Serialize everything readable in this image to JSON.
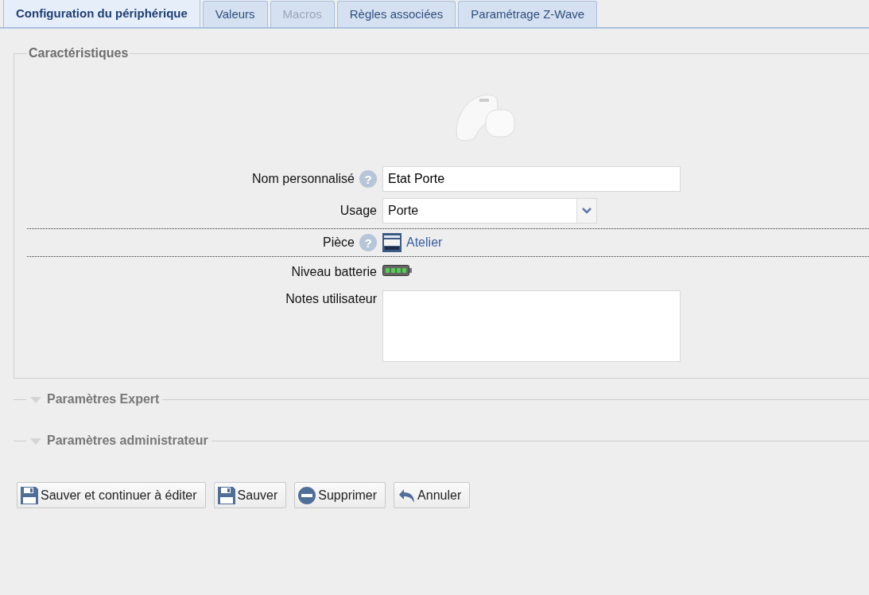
{
  "tabs": [
    {
      "label": "Configuration du périphérique",
      "selected": true,
      "disabled": false
    },
    {
      "label": "Valeurs",
      "selected": false,
      "disabled": false
    },
    {
      "label": "Macros",
      "selected": false,
      "disabled": true
    },
    {
      "label": "Règles associées",
      "selected": false,
      "disabled": false
    },
    {
      "label": "Paramétrage Z-Wave",
      "selected": false,
      "disabled": false
    }
  ],
  "characteristics": {
    "legend": "Caractéristiques",
    "fields": [
      {
        "kind": "text",
        "label": "Nom personnalisé",
        "help": "?",
        "value": "Etat Porte"
      },
      {
        "kind": "select",
        "label": "Usage",
        "value": "Porte"
      },
      {
        "kind": "link",
        "label": "Pièce",
        "help": "?",
        "value": "Atelier"
      },
      {
        "kind": "battery",
        "label": "Niveau batterie"
      },
      {
        "kind": "textarea",
        "label": "Notes utilisateur"
      }
    ]
  },
  "sections": [
    {
      "title": "Paramètres Expert",
      "expanded": false
    },
    {
      "title": "Paramètres administrateur",
      "expanded": false
    }
  ],
  "buttons": [
    {
      "kind": "save",
      "label": "Sauver et continuer à éditer"
    },
    {
      "kind": "save",
      "label": "Sauver"
    },
    {
      "kind": "delete",
      "label": "Supprimer"
    },
    {
      "kind": "undo",
      "label": "Annuler"
    }
  ]
}
